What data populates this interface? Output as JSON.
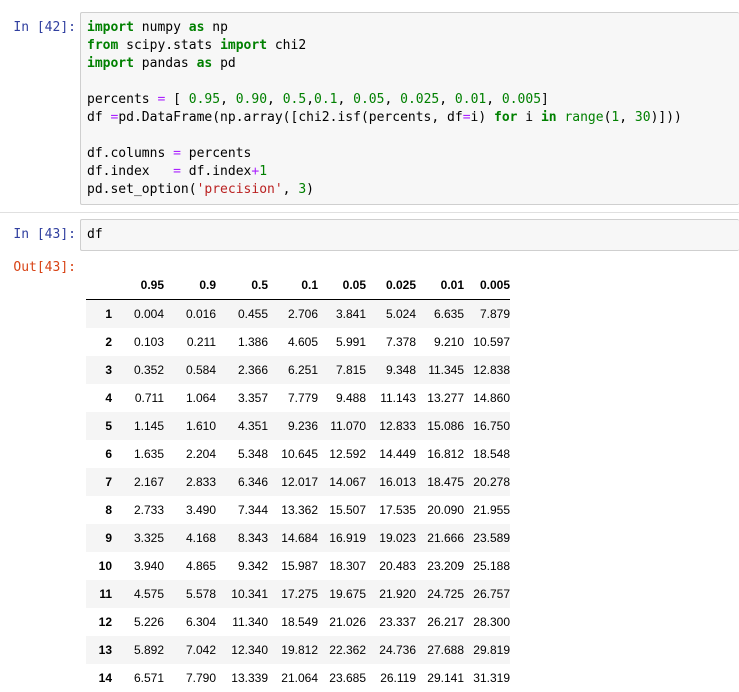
{
  "cells": [
    {
      "prompt": "In [42]:",
      "code_lines": [
        [
          {
            "t": "kw",
            "v": "import"
          },
          {
            "t": "",
            "v": " numpy "
          },
          {
            "t": "kw",
            "v": "as"
          },
          {
            "t": "",
            "v": " np"
          }
        ],
        [
          {
            "t": "kw",
            "v": "from"
          },
          {
            "t": "",
            "v": " scipy.stats "
          },
          {
            "t": "kw",
            "v": "import"
          },
          {
            "t": "",
            "v": " chi2"
          }
        ],
        [
          {
            "t": "kw",
            "v": "import"
          },
          {
            "t": "",
            "v": " pandas "
          },
          {
            "t": "kw",
            "v": "as"
          },
          {
            "t": "",
            "v": " pd"
          }
        ],
        [],
        [
          {
            "t": "",
            "v": "percents "
          },
          {
            "t": "op",
            "v": "="
          },
          {
            "t": "",
            "v": " [ "
          },
          {
            "t": "num",
            "v": "0.95"
          },
          {
            "t": "",
            "v": ", "
          },
          {
            "t": "num",
            "v": "0.90"
          },
          {
            "t": "",
            "v": ", "
          },
          {
            "t": "num",
            "v": "0.5"
          },
          {
            "t": "",
            "v": ","
          },
          {
            "t": "num",
            "v": "0.1"
          },
          {
            "t": "",
            "v": ", "
          },
          {
            "t": "num",
            "v": "0.05"
          },
          {
            "t": "",
            "v": ", "
          },
          {
            "t": "num",
            "v": "0.025"
          },
          {
            "t": "",
            "v": ", "
          },
          {
            "t": "num",
            "v": "0.01"
          },
          {
            "t": "",
            "v": ", "
          },
          {
            "t": "num",
            "v": "0.005"
          },
          {
            "t": "",
            "v": "]"
          }
        ],
        [
          {
            "t": "",
            "v": "df "
          },
          {
            "t": "op",
            "v": "="
          },
          {
            "t": "",
            "v": "pd.DataFrame(np.array([chi2.isf(percents, df"
          },
          {
            "t": "op",
            "v": "="
          },
          {
            "t": "",
            "v": "i) "
          },
          {
            "t": "kw",
            "v": "for"
          },
          {
            "t": "",
            "v": " i "
          },
          {
            "t": "kw",
            "v": "in"
          },
          {
            "t": "",
            "v": " "
          },
          {
            "t": "bi",
            "v": "range"
          },
          {
            "t": "",
            "v": "("
          },
          {
            "t": "num",
            "v": "1"
          },
          {
            "t": "",
            "v": ", "
          },
          {
            "t": "num",
            "v": "30"
          },
          {
            "t": "",
            "v": ")]))"
          }
        ],
        [],
        [
          {
            "t": "",
            "v": "df.columns "
          },
          {
            "t": "op",
            "v": "="
          },
          {
            "t": "",
            "v": " percents"
          }
        ],
        [
          {
            "t": "",
            "v": "df.index   "
          },
          {
            "t": "op",
            "v": "="
          },
          {
            "t": "",
            "v": " df.index"
          },
          {
            "t": "op",
            "v": "+"
          },
          {
            "t": "num",
            "v": "1"
          }
        ],
        [
          {
            "t": "",
            "v": "pd.set_option("
          },
          {
            "t": "str",
            "v": "'precision'"
          },
          {
            "t": "",
            "v": ", "
          },
          {
            "t": "num",
            "v": "3"
          },
          {
            "t": "",
            "v": ")"
          }
        ]
      ]
    },
    {
      "prompt": "In [43]:",
      "code_lines": [
        [
          {
            "t": "",
            "v": "df"
          }
        ]
      ]
    }
  ],
  "output": {
    "prompt": "Out[43]:",
    "columns": [
      "0.95",
      "0.9",
      "0.5",
      "0.1",
      "0.05",
      "0.025",
      "0.01",
      "0.005"
    ],
    "rows": [
      {
        "index": "1",
        "values": [
          "0.004",
          "0.016",
          "0.455",
          "2.706",
          "3.841",
          "5.024",
          "6.635",
          "7.879"
        ]
      },
      {
        "index": "2",
        "values": [
          "0.103",
          "0.211",
          "1.386",
          "4.605",
          "5.991",
          "7.378",
          "9.210",
          "10.597"
        ]
      },
      {
        "index": "3",
        "values": [
          "0.352",
          "0.584",
          "2.366",
          "6.251",
          "7.815",
          "9.348",
          "11.345",
          "12.838"
        ]
      },
      {
        "index": "4",
        "values": [
          "0.711",
          "1.064",
          "3.357",
          "7.779",
          "9.488",
          "11.143",
          "13.277",
          "14.860"
        ]
      },
      {
        "index": "5",
        "values": [
          "1.145",
          "1.610",
          "4.351",
          "9.236",
          "11.070",
          "12.833",
          "15.086",
          "16.750"
        ]
      },
      {
        "index": "6",
        "values": [
          "1.635",
          "2.204",
          "5.348",
          "10.645",
          "12.592",
          "14.449",
          "16.812",
          "18.548"
        ]
      },
      {
        "index": "7",
        "values": [
          "2.167",
          "2.833",
          "6.346",
          "12.017",
          "14.067",
          "16.013",
          "18.475",
          "20.278"
        ]
      },
      {
        "index": "8",
        "values": [
          "2.733",
          "3.490",
          "7.344",
          "13.362",
          "15.507",
          "17.535",
          "20.090",
          "21.955"
        ]
      },
      {
        "index": "9",
        "values": [
          "3.325",
          "4.168",
          "8.343",
          "14.684",
          "16.919",
          "19.023",
          "21.666",
          "23.589"
        ]
      },
      {
        "index": "10",
        "values": [
          "3.940",
          "4.865",
          "9.342",
          "15.987",
          "18.307",
          "20.483",
          "23.209",
          "25.188"
        ]
      },
      {
        "index": "11",
        "values": [
          "4.575",
          "5.578",
          "10.341",
          "17.275",
          "19.675",
          "21.920",
          "24.725",
          "26.757"
        ]
      },
      {
        "index": "12",
        "values": [
          "5.226",
          "6.304",
          "11.340",
          "18.549",
          "21.026",
          "23.337",
          "26.217",
          "28.300"
        ]
      },
      {
        "index": "13",
        "values": [
          "5.892",
          "7.042",
          "12.340",
          "19.812",
          "22.362",
          "24.736",
          "27.688",
          "29.819"
        ]
      },
      {
        "index": "14",
        "values": [
          "6.571",
          "7.790",
          "13.339",
          "21.064",
          "23.685",
          "26.119",
          "29.141",
          "31.319"
        ]
      }
    ]
  }
}
